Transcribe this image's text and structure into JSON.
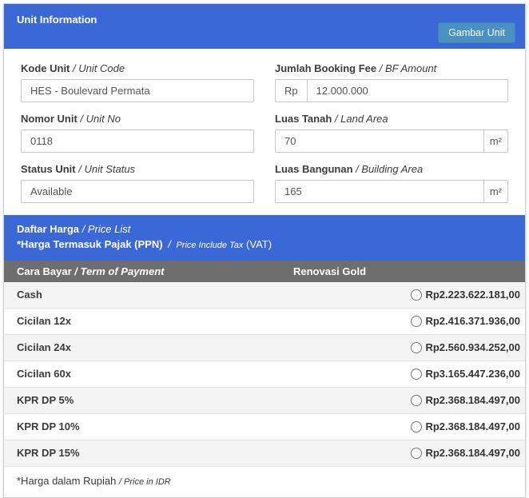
{
  "separator": "/",
  "colors": {
    "header_blue": "#3b68d7",
    "button_blue": "#4a90c2",
    "table_header_gray": "#6e6e6e",
    "stripe_gray": "#f4f4f4"
  },
  "header": {
    "title": "Unit Information",
    "button_label": "Gambar Unit"
  },
  "form": {
    "fields": [
      {
        "label": "Kode Unit",
        "label_en": "/ Unit Code",
        "value": "HES - Boulevard Permata"
      },
      {
        "label": "Jumlah Booking Fee",
        "label_en": "/ BF Amount",
        "prefix": "Rp",
        "value": "12.000.000"
      },
      {
        "label": "Nomor Unit",
        "label_en": "/ Unit No",
        "value": "0118"
      },
      {
        "label": "Luas Tanah",
        "label_en": "/ Land Area",
        "value": "70",
        "suffix": "m²"
      },
      {
        "label": "Status Unit",
        "label_en": "/ Unit Status",
        "value": "Available"
      },
      {
        "label": "Luas Bangunan",
        "label_en": "/ Building Area",
        "value": "165",
        "suffix": "m²"
      }
    ]
  },
  "price_section": {
    "title": "Daftar Harga",
    "title_en": "/ Price List",
    "subtitle": "*Harga Termasuk Pajak (PPN)",
    "subtitle_sep": "/",
    "subtitle_en": "Price Include Tax",
    "subtitle_vat": "(VAT)",
    "table": {
      "col1_header": "Cara Bayar",
      "col1_header_en": "/ Term of Payment",
      "col2_header": "Renovasi Gold",
      "rows": [
        {
          "label": "Cash",
          "price": "Rp2.223.622.181,00"
        },
        {
          "label": "Cicilan 12x",
          "price": "Rp2.416.371.936,00"
        },
        {
          "label": "Cicilan 24x",
          "price": "Rp2.560.934.252,00"
        },
        {
          "label": "Cicilan 60x",
          "price": "Rp3.165.447.236,00"
        },
        {
          "label": "KPR DP 5%",
          "price": "Rp2.368.184.497,00"
        },
        {
          "label": "KPR DP 10%",
          "price": "Rp2.368.184.497,00"
        },
        {
          "label": "KPR DP 15%",
          "price": "Rp2.368.184.497,00"
        }
      ]
    },
    "footnote": "*Harga dalam Rupiah",
    "footnote_en": "/ Price in IDR"
  }
}
